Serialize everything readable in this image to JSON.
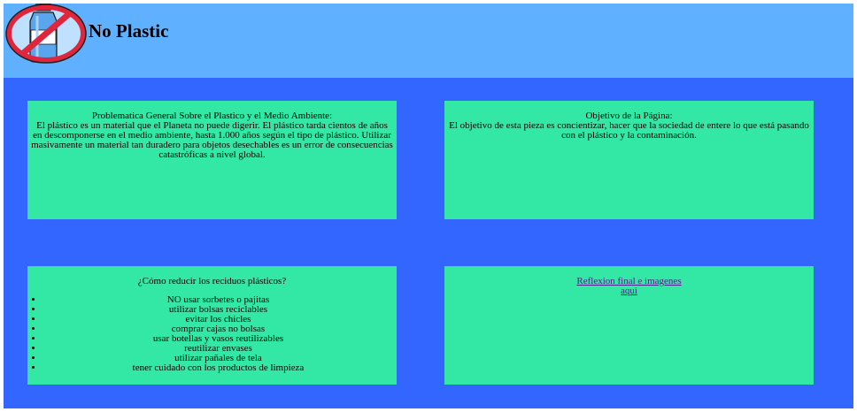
{
  "header": {
    "logo_icon": "no-plastic-bottle-icon",
    "title": "No Plastic"
  },
  "cards": {
    "problem": {
      "heading": "Problematica General Sobre el Plastico y el Medio Ambiente:",
      "body": "El plástico es un material que el Planeta no puede digerir. El plástico tarda cientos de años en descomponerse en el medio ambiente, hasta 1.000 años según el tipo de plástico. Utilizar masivamente un material tan duradero para objetos desechables es un error de consecuencias catastróficas a nivel global."
    },
    "objective": {
      "heading": "Objetivo de la Página:",
      "body": "El objetivo de esta pieza es concientizar, hacer que la sociedad de entere lo que está pasando con el plástico y la contaminación."
    },
    "reduce": {
      "heading": "¿Cómo reducir los reciduos plásticos?",
      "items": [
        "NO usar sorbetes o pajitas",
        "utilizar bolsas reciclables",
        "evitar los chicles",
        "comprar cajas no bolsas",
        "usar botellas y vasos reutilizables",
        "reutilizar envases",
        "utilizar pañales de tela",
        "tener cuidado con los productos de limpieza"
      ]
    },
    "reflection": {
      "text": "Reflexion final e imagenes",
      "link": "aqui"
    }
  },
  "colors": {
    "page_bg": "#3366ff",
    "header_bg": "#5fb1ff",
    "card_bg": "#33e8a4"
  }
}
